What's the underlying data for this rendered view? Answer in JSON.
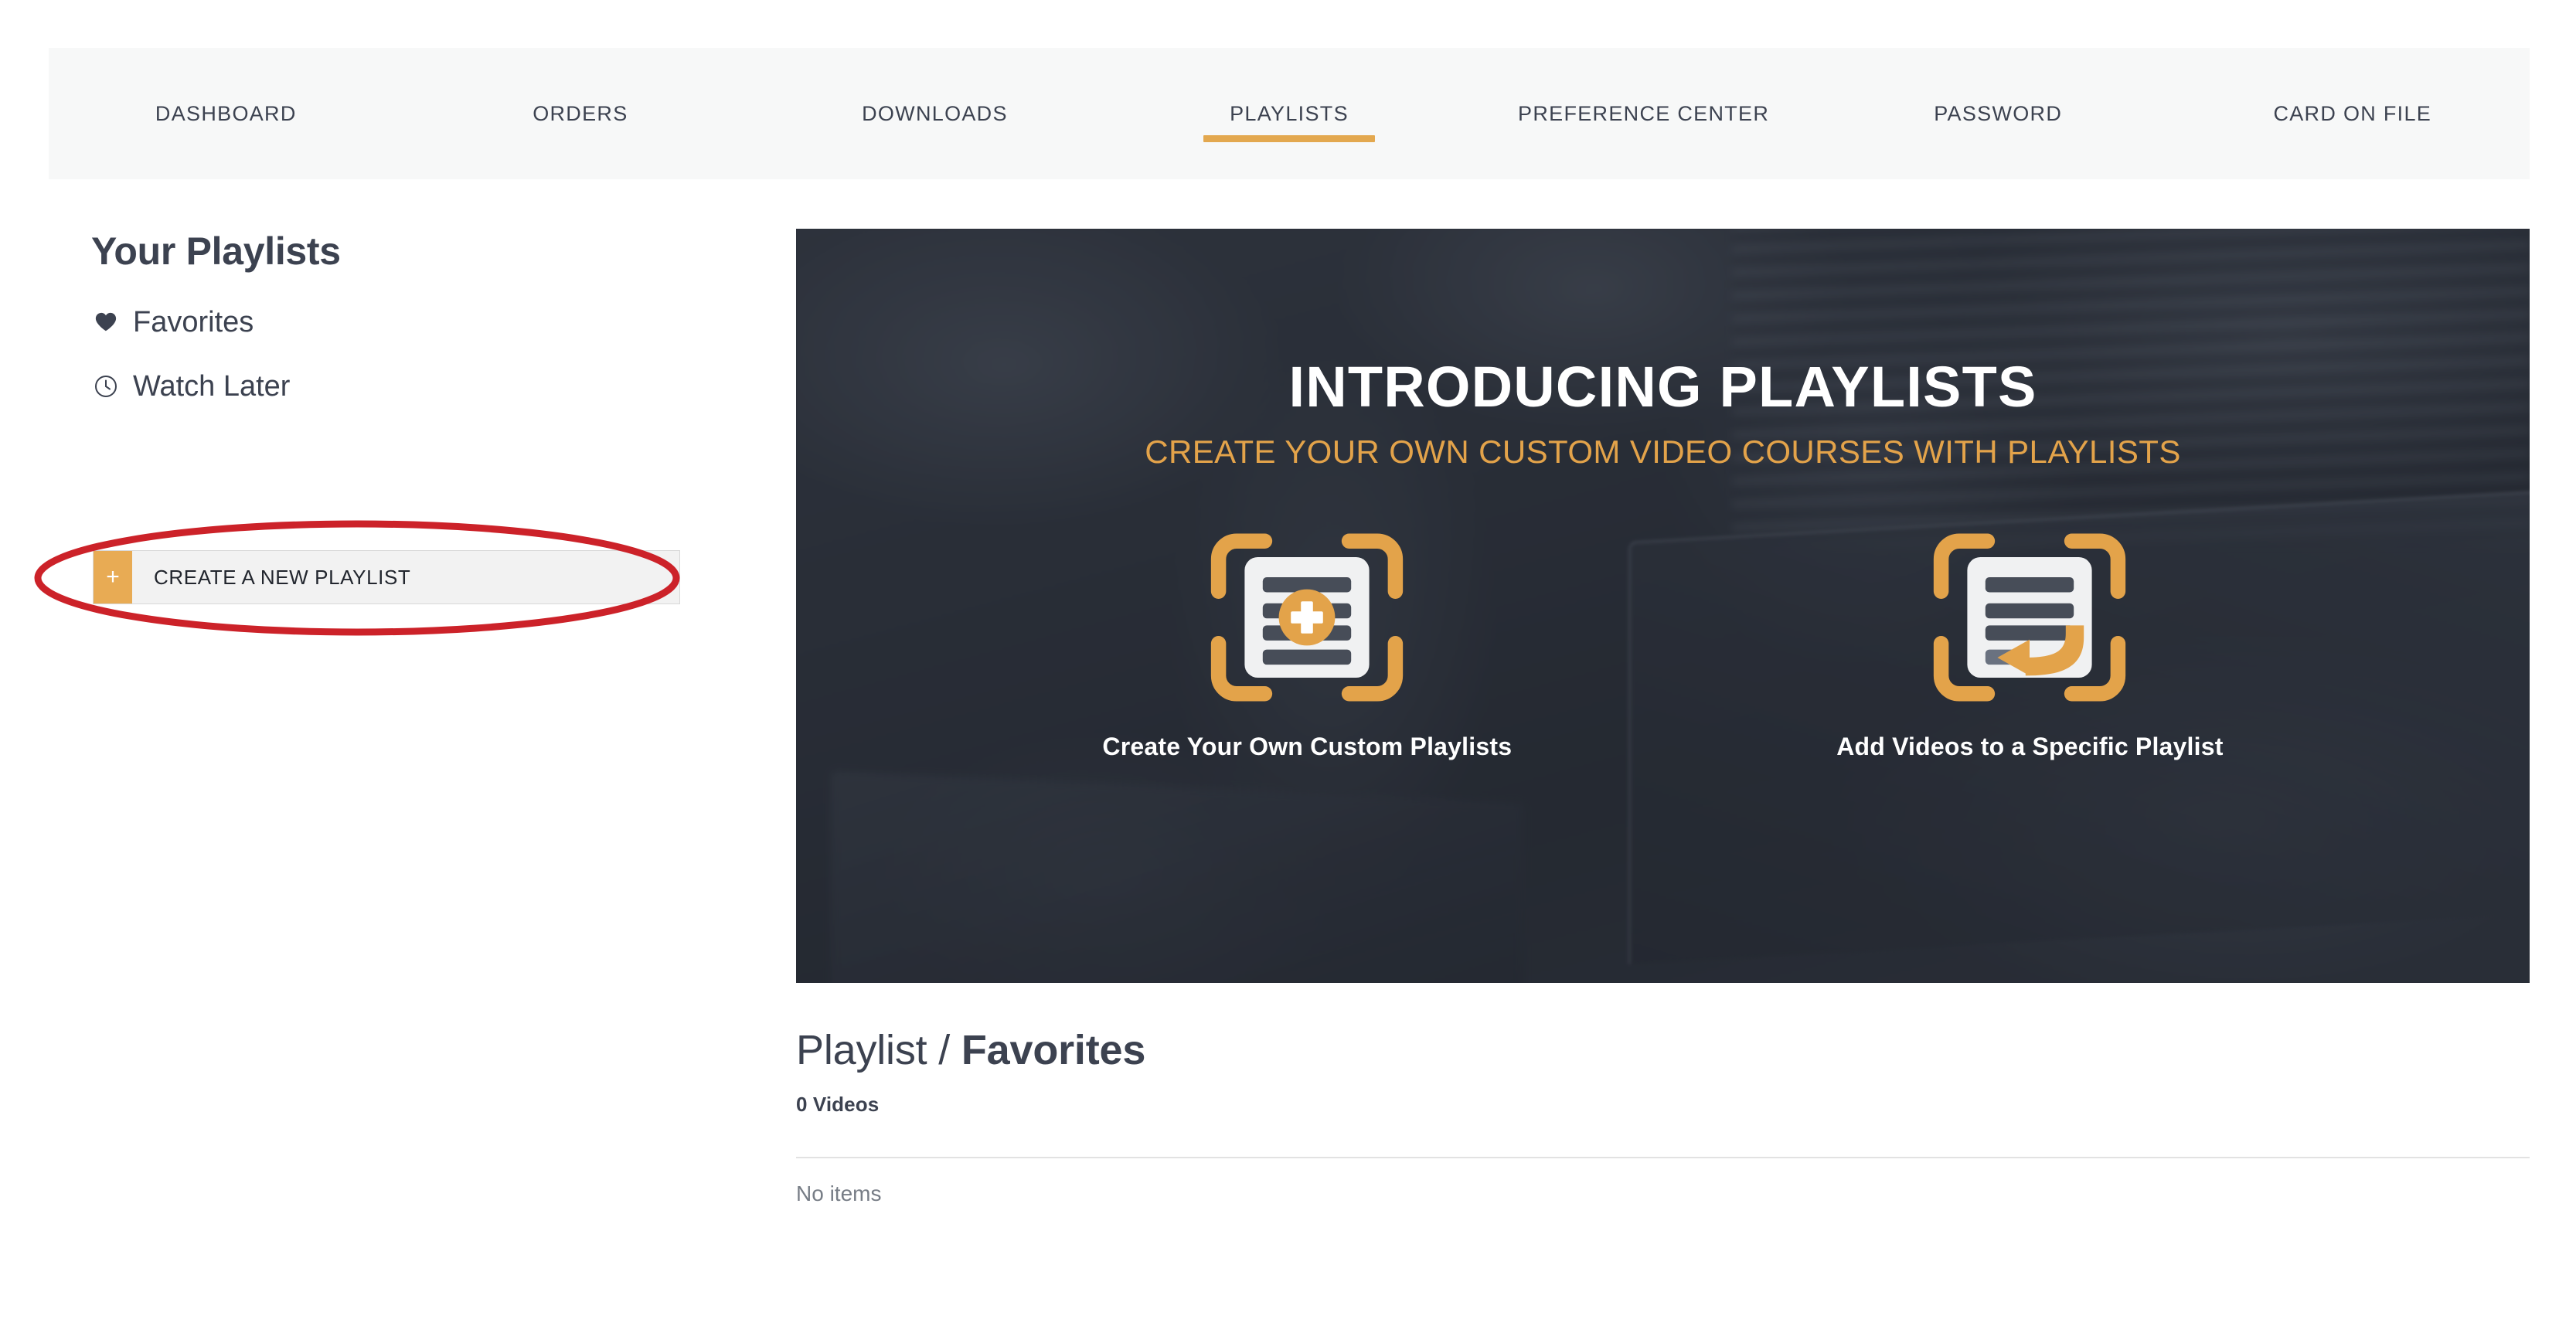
{
  "account_nav": {
    "tabs": [
      {
        "label": "DASHBOARD",
        "active": false
      },
      {
        "label": "ORDERS",
        "active": false
      },
      {
        "label": "DOWNLOADS",
        "active": false
      },
      {
        "label": "PLAYLISTS",
        "active": true
      },
      {
        "label": "PREFERENCE CENTER",
        "active": false
      },
      {
        "label": "PASSWORD",
        "active": false
      },
      {
        "label": "CARD ON FILE",
        "active": false
      }
    ]
  },
  "sidebar": {
    "title": "Your Playlists",
    "items": [
      {
        "label": "Favorites",
        "icon": "heart-icon"
      },
      {
        "label": "Watch Later",
        "icon": "clock-icon"
      }
    ],
    "create_button": {
      "plus": "+",
      "label": "CREATE A NEW PLAYLIST"
    }
  },
  "annotation": {
    "type": "ellipse-highlight",
    "color": "#cc2229",
    "target": "create-a-new-playlist-button"
  },
  "hero": {
    "title": "INTRODUCING PLAYLISTS",
    "subtitle": "CREATE YOUR OWN CUSTOM VIDEO COURSES WITH PLAYLISTS",
    "features": [
      {
        "caption": "Create Your Own Custom Playlists",
        "icon": "playlist-add-icon"
      },
      {
        "caption": "Add Videos to a Specific Playlist",
        "icon": "playlist-arrow-icon"
      }
    ]
  },
  "detail": {
    "heading_prefix": "Playlist /",
    "heading_name": "Favorites",
    "video_count": "0 Videos",
    "empty_message": "No items"
  },
  "colors": {
    "accent_orange": "#e3a84f",
    "text_dark": "#3c4250",
    "nav_background": "#f7f8f8",
    "hero_background": "#2b2f38",
    "annotation_red": "#cc2229"
  }
}
